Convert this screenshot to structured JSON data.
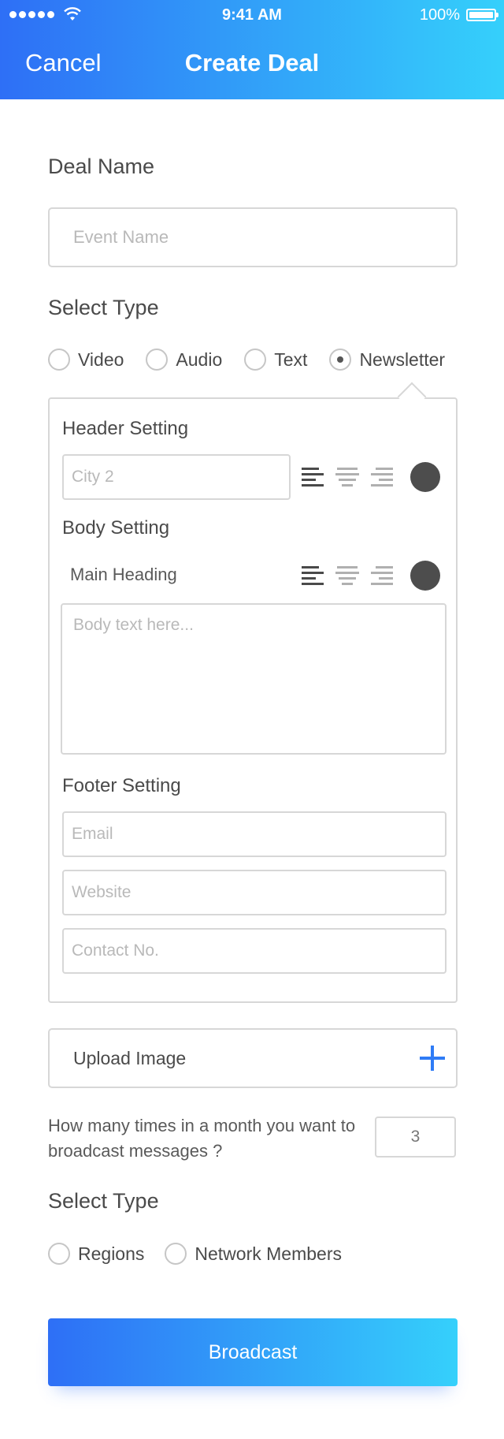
{
  "status_bar": {
    "time": "9:41 AM",
    "battery": "100%"
  },
  "nav": {
    "cancel": "Cancel",
    "title": "Create Deal"
  },
  "deal_name": {
    "label": "Deal Name",
    "placeholder": "Event Name"
  },
  "select_type_1": {
    "label": "Select Type",
    "options": [
      "Video",
      "Audio",
      "Text",
      "Newsletter"
    ],
    "selected": "Newsletter"
  },
  "newsletter": {
    "header_label": "Header Setting",
    "header_placeholder": "City 2",
    "body_label": "Body Setting",
    "main_heading": "Main Heading",
    "body_placeholder": "Body text here...",
    "footer_label": "Footer Setting",
    "email_placeholder": "Email",
    "website_placeholder": "Website",
    "contact_placeholder": "Contact No.",
    "text_color": "#4d4d4d"
  },
  "upload": {
    "label": "Upload Image"
  },
  "broadcast_question": {
    "text": "How many times in a month you want to broadcast messages ?",
    "value": "3"
  },
  "select_type_2": {
    "label": "Select Type",
    "options": [
      "Regions",
      "Network Members"
    ]
  },
  "broadcast_button": {
    "label": "Broadcast"
  },
  "colors": {
    "gradient_start": "#2e6ff6",
    "gradient_end": "#35d0fb",
    "accent": "#2f7cf6"
  }
}
